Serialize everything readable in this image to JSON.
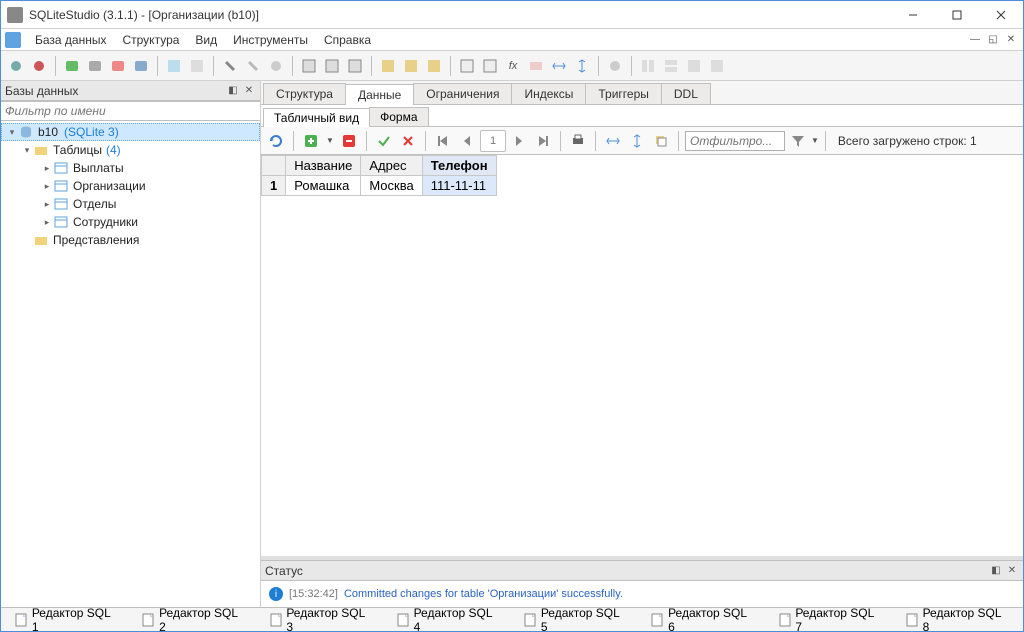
{
  "title": "SQLiteStudio (3.1.1) - [Организации (b10)]",
  "menu": [
    "База данных",
    "Структура",
    "Вид",
    "Инструменты",
    "Справка"
  ],
  "sidebar": {
    "title": "Базы данных",
    "filter_placeholder": "Фильтр по имени",
    "db_name": "b10",
    "db_engine": "(SQLite 3)",
    "tables_label": "Таблицы",
    "tables_count": "(4)",
    "tables": [
      "Выплаты",
      "Организации",
      "Отделы",
      "Сотрудники"
    ],
    "views_label": "Представления"
  },
  "tabs": {
    "main": [
      "Структура",
      "Данные",
      "Ограничения",
      "Индексы",
      "Триггеры",
      "DDL"
    ],
    "active_main": 1,
    "sub": [
      "Табличный вид",
      "Форма"
    ],
    "active_sub": 0
  },
  "data_toolbar": {
    "filter_placeholder": "Отфильтро...",
    "loaded_label": "Всего загружено строк: 1"
  },
  "grid": {
    "columns": [
      "Название",
      "Адрес",
      "Телефон"
    ],
    "selected_col": 2,
    "rows": [
      {
        "num": "1",
        "cells": [
          "Ромашка",
          "Москва",
          "111-11-11"
        ]
      }
    ]
  },
  "status": {
    "title": "Статус",
    "time": "[15:32:42]",
    "message": "Committed changes for table 'Организации' successfully."
  },
  "bottom_tabs": [
    "Редактор SQL 1",
    "Редактор SQL 2",
    "Редактор SQL 3",
    "Редактор SQL 4",
    "Редактор SQL 5",
    "Редактор SQL 6",
    "Редактор SQL 7",
    "Редактор SQL 8"
  ]
}
